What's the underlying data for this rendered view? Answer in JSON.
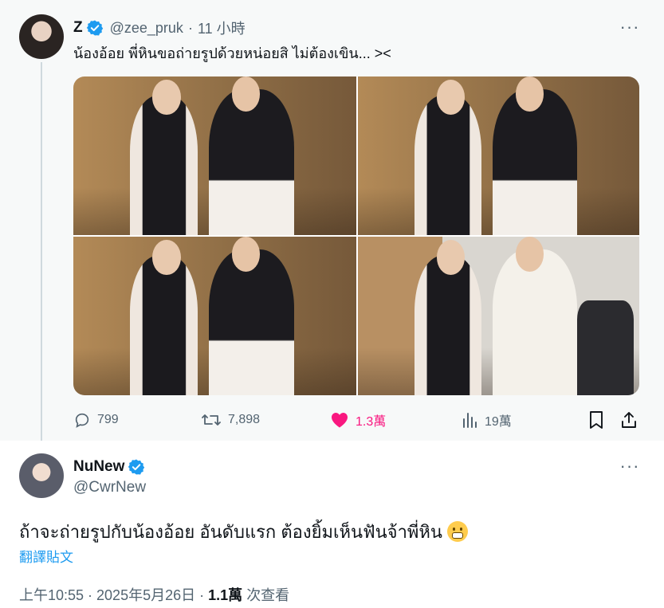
{
  "parent": {
    "display_name": "Z",
    "handle": "@zee_pruk",
    "separator": "·",
    "time": "11 小時",
    "text": "น้องอ้อย พี่หินขอถ่ายรูปด้วยหน่อยสิ ไม่ต้องเขิน... ><",
    "more": "···",
    "stats": {
      "replies": "799",
      "reposts": "7,898",
      "likes": "1.3萬",
      "views": "19萬"
    }
  },
  "reply": {
    "display_name": "NuNew",
    "handle": "@CwrNew",
    "more": "···",
    "text": "ถ้าจะถ่ายรูปกับน้องอ้อย อันดับแรก ต้องยิ้มเห็นฟันจ้าพี่หิน",
    "translate_label": "翻譯貼文",
    "timestamp": "上午10:55 · 2025年5月26日 ·",
    "view_count": "1.1萬",
    "view_label": "次查看"
  },
  "icons": {
    "verified": "verified-badge-icon",
    "reply": "reply-icon",
    "repost": "repost-icon",
    "like": "heart-icon",
    "views": "views-icon",
    "bookmark": "bookmark-icon",
    "share": "share-icon",
    "emoji": "grimacing-face-emoji"
  },
  "colors": {
    "accent": "#1d9bf0",
    "like": "#f91880",
    "muted": "#536471",
    "parent_bg": "#f7f9f9"
  }
}
